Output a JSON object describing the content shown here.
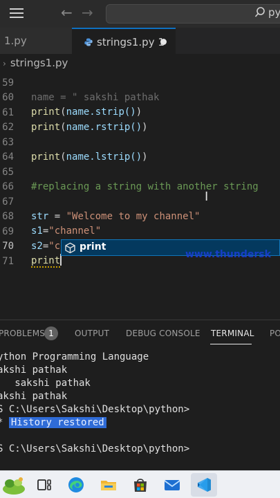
{
  "title_bar": {
    "search_text": "py",
    "icons": [
      "menu-icon",
      "back-arrow-icon",
      "forward-arrow-icon",
      "search-icon"
    ]
  },
  "tabs": [
    {
      "label": "1.py",
      "active": false
    },
    {
      "label": "strings1.py 1",
      "active": true,
      "dirty": true
    }
  ],
  "breadcrumb": {
    "file": "strings1.py"
  },
  "editor": {
    "lines": [
      {
        "num": "59",
        "text": "name = \" sakshi pathak",
        "ghost": true
      },
      {
        "num": "60",
        "fn": "print",
        "arg": "name.strip()"
      },
      {
        "num": "61",
        "fn": "print",
        "arg": "name.rstrip()"
      },
      {
        "num": "62",
        "text": ""
      },
      {
        "num": "63",
        "fn": "print",
        "arg": "name.lstrip()"
      },
      {
        "num": "64",
        "text": ""
      },
      {
        "num": "65",
        "comment": "#replacing a string with another string"
      },
      {
        "num": "66",
        "text": ""
      },
      {
        "num": "67",
        "var": "str",
        "op": " = ",
        "str": "\"Welcome to my channel\""
      },
      {
        "num": "68",
        "var": "s1",
        "op": "=",
        "str": "\"channel\""
      },
      {
        "num": "69",
        "var": "s2",
        "op": "=",
        "str": "\"class\""
      },
      {
        "num": "70",
        "typed": "print",
        "active": true
      },
      {
        "num": "71",
        "text": ""
      }
    ]
  },
  "autocomplete": {
    "label": "print",
    "icon": "cube-icon"
  },
  "watermark": "www.thundersk",
  "panel": {
    "tabs": [
      "PROBLEMS",
      "OUTPUT",
      "DEBUG CONSOLE",
      "TERMINAL",
      "PO"
    ],
    "problems_count": "1",
    "active_tab": "TERMINAL",
    "terminal_lines": [
      "ython Programming Language",
      "akshi pathak",
      "   sakshi pathak",
      "akshi pathak",
      "S C:\\Users\\Sakshi\\Desktop\\python>",
      "",
      "",
      "S C:\\Users\\Sakshi\\Desktop\\python>"
    ],
    "history_star": "*",
    "history_text": "History restored"
  },
  "taskbar": {
    "apps": [
      "widgets-icon",
      "task-view-icon",
      "edge-icon",
      "file-explorer-icon",
      "store-icon",
      "mail-icon",
      "vscode-icon"
    ]
  },
  "colors": {
    "editor_bg": "#1e1e1e",
    "accent": "#0e70c0",
    "function": "#dcdcaa",
    "variable": "#9cdcfe",
    "string": "#ce9178",
    "comment": "#6a9955"
  }
}
